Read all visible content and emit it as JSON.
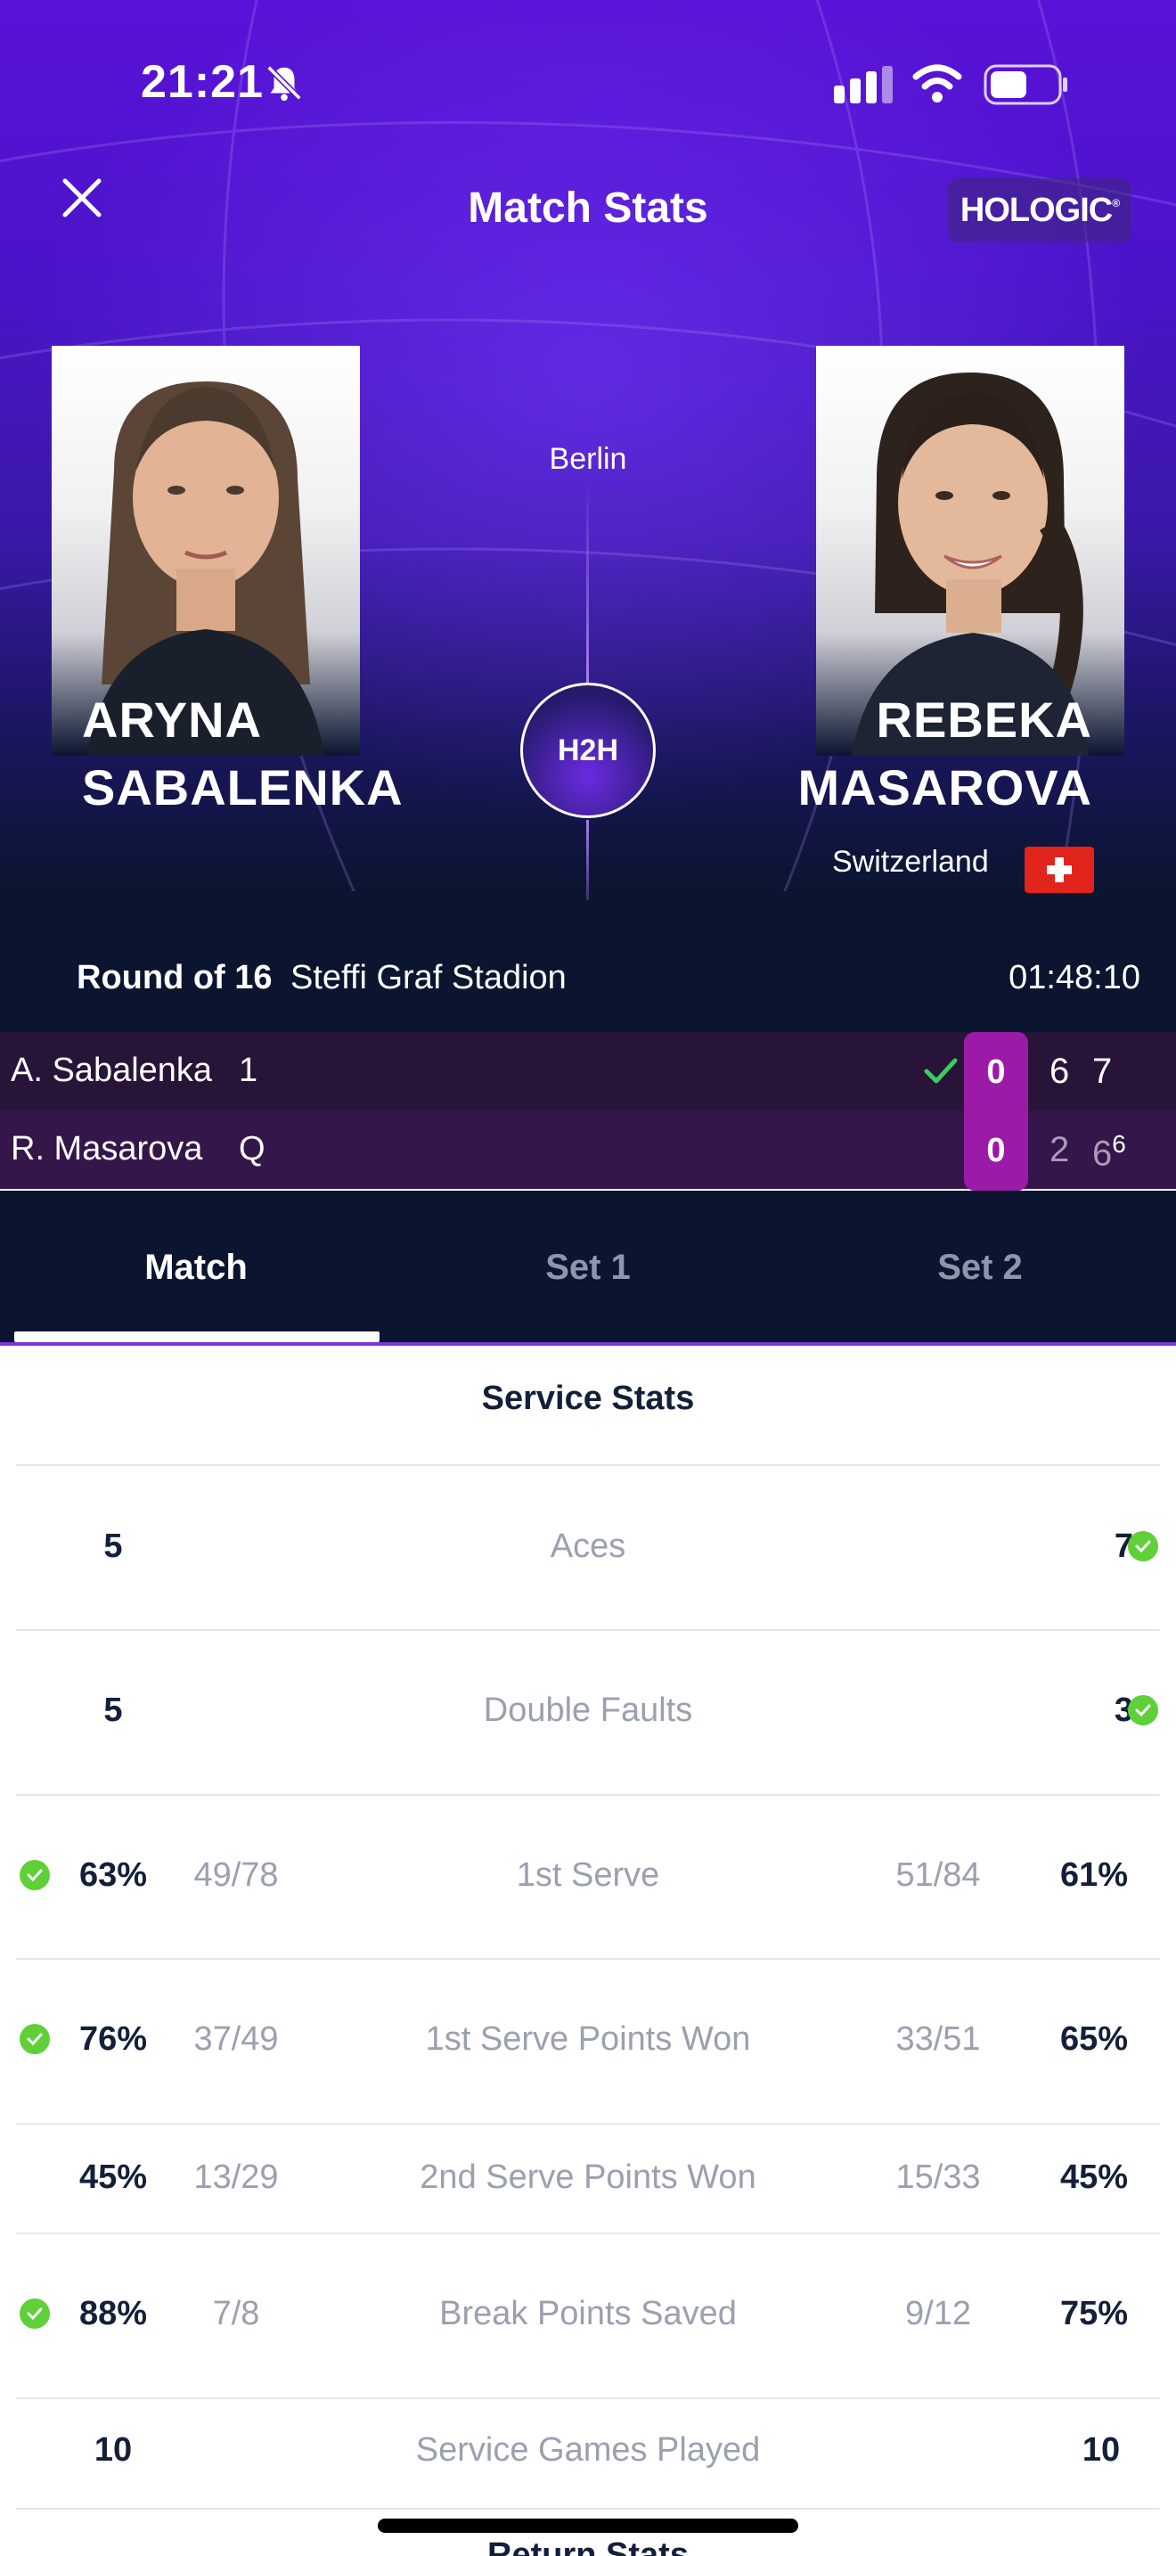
{
  "status_bar": {
    "time": "21:21",
    "battery_level": 0.55
  },
  "header": {
    "title": "Match Stats",
    "sponsor": "HOLOGIC"
  },
  "match": {
    "city": "Berlin",
    "h2h_label": "H2H",
    "round": "Round of 16",
    "venue": "Steffi Graf Stadion",
    "duration": "01:48:10"
  },
  "players": {
    "left": {
      "first_name": "ARYNA",
      "last_name": "SABALENKA"
    },
    "right": {
      "first_name": "REBEKA",
      "last_name": "MASAROVA",
      "country": "Switzerland"
    }
  },
  "scoreboard": [
    {
      "name": "A. Sabalenka",
      "seed": "1",
      "game": "0",
      "sets": [
        "6",
        "7"
      ],
      "tiebreak": "",
      "winner": true
    },
    {
      "name": "R. Masarova",
      "seed": "Q",
      "game": "0",
      "sets": [
        "2",
        "6"
      ],
      "tiebreak": "6",
      "winner": false
    }
  ],
  "tabs": [
    {
      "label": "Match",
      "active": true
    },
    {
      "label": "Set 1",
      "active": false
    },
    {
      "label": "Set 2",
      "active": false
    }
  ],
  "service_stats": {
    "title": "Service Stats",
    "rows": [
      {
        "label": "Aces",
        "left": "5",
        "right": "7",
        "left_frac": "",
        "right_frac": "",
        "winner": "right"
      },
      {
        "label": "Double Faults",
        "left": "5",
        "right": "3",
        "left_frac": "",
        "right_frac": "",
        "winner": "right"
      },
      {
        "label": "1st Serve",
        "left": "63%",
        "right": "61%",
        "left_frac": "49/78",
        "right_frac": "51/84",
        "winner": "left"
      },
      {
        "label": "1st Serve Points Won",
        "left": "76%",
        "right": "65%",
        "left_frac": "37/49",
        "right_frac": "33/51",
        "winner": "left"
      },
      {
        "label": "2nd Serve Points Won",
        "left": "45%",
        "right": "45%",
        "left_frac": "13/29",
        "right_frac": "15/33",
        "winner": ""
      },
      {
        "label": "Break Points Saved",
        "left": "88%",
        "right": "75%",
        "left_frac": "7/8",
        "right_frac": "9/12",
        "winner": "left"
      },
      {
        "label": "Service Games Played",
        "left": "10",
        "right": "10",
        "left_frac": "",
        "right_frac": "",
        "winner": ""
      }
    ]
  },
  "next_section_title": "Return Stats",
  "colors": {
    "accent": "#9c1aa8",
    "win": "#5fd038",
    "dark": "#0b1530"
  }
}
